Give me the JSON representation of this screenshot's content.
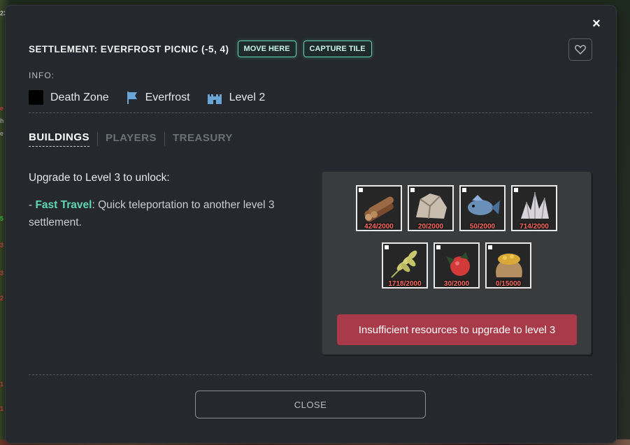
{
  "modal": {
    "title": "SETTLEMENT: EVERFROST PICNIC (-5, 4)",
    "move_here_label": "MOVE HERE",
    "capture_tile_label": "CAPTURE TILE",
    "close_x": "×"
  },
  "info": {
    "label": "INFO:",
    "zone": "Death Zone",
    "faction": "Everfrost",
    "level": "Level 2",
    "faction_color": "#6aa5d8"
  },
  "tabs": [
    {
      "label": "BUILDINGS",
      "active": true
    },
    {
      "label": "PLAYERS",
      "active": false
    },
    {
      "label": "TREASURY",
      "active": false
    }
  ],
  "upgrade": {
    "title": "Upgrade to Level 3 to unlock:",
    "prefix": "- ",
    "feature": "Fast Travel",
    "description": ": Quick teleportation to another level 3 settlement."
  },
  "resources": [
    {
      "icon": "wood-logs-icon",
      "count": "424/2000"
    },
    {
      "icon": "stone-icon",
      "count": "20/2000"
    },
    {
      "icon": "fish-icon",
      "count": "50/2000"
    },
    {
      "icon": "crystal-icon",
      "count": "714/2000"
    },
    {
      "icon": "wheat-icon",
      "count": "1718/2000"
    },
    {
      "icon": "berry-icon",
      "count": "30/2000"
    },
    {
      "icon": "gold-sack-icon",
      "count": "0/15000"
    }
  ],
  "insufficient_label": "Insufficient resources to upgrade to level 3",
  "close_label": "CLOSE",
  "colors": {
    "accent": "#5fd6b4",
    "danger": "#a93a4a",
    "count_red": "#ff6b62"
  }
}
